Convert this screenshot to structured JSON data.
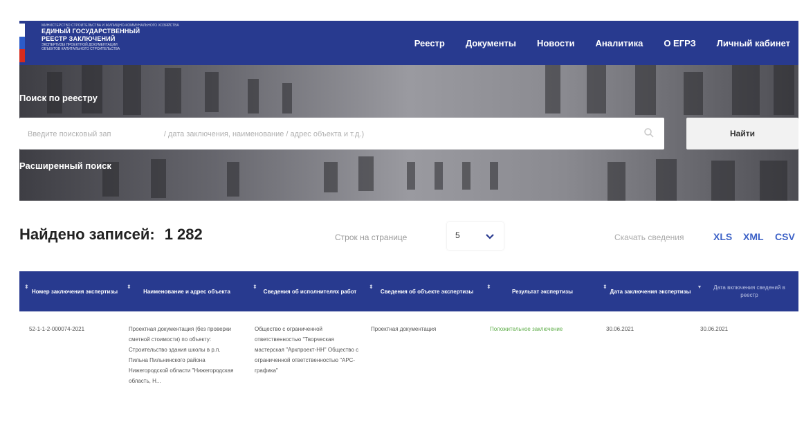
{
  "header": {
    "logo_small": "МИНИСТЕРСТВО СТРОИТЕЛЬСТВА И ЖИЛИЩНО-КОММУНАЛЬНОГО ХОЗЯЙСТВА",
    "logo_line1": "ЕДИНЫЙ ГОСУДАРСТВЕННЫЙ",
    "logo_line2": "РЕЕСТР ЗАКЛЮЧЕНИЙ",
    "logo_sub1": "ЭКСПЕРТИЗЫ ПРОЕКТНОЙ ДОКУМЕНТАЦИИ",
    "logo_sub2": "ОБЪЕКТОВ КАПИТАЛЬНОГО СТРОИТЕЛЬСТВА",
    "flag_colors": [
      "#ffffff",
      "#2c5bc9",
      "#d52b1e"
    ],
    "nav": [
      "Реестр",
      "Документы",
      "Новости",
      "Аналитика",
      "О ЕГРЗ",
      "Личный кабинет"
    ]
  },
  "hero": {
    "search_title": "Поиск по реестру",
    "search_placeholder": "Введите поисковый зап                         / дата заключения, наименование / адрес объекта и т.д.)",
    "search_icon": "search-icon",
    "find_label": "Найти",
    "advanced_label": "Расширенный поиск"
  },
  "results": {
    "found_label": "Найдено записей:",
    "found_count": "1 282",
    "rows_label": "Строк на странице",
    "rows_value": "5",
    "download_label": "Скачать сведения",
    "formats": [
      "XLS",
      "XML",
      "CSV"
    ]
  },
  "table": {
    "columns": [
      "Номер заключения экспертизы",
      "Наименование и адрес объекта",
      "Сведения об исполнителях работ",
      "Сведения об объекте экспертизы",
      "Результат экспертизы",
      "Дата заключения экспертизы",
      "Дата включения сведений в реестр"
    ],
    "row": {
      "number": "52-1-1-2-000074-2021",
      "object": "Проектная документация (без проверки сметной стоимости) по объекту: Строительство здания школы в р.п. Пильна Пильнинского района Нижегородской области \"Нижегородская область, Н...",
      "executors": "Общество с ограниченной ответственностью \"Творческая мастерская \"Архпроект-НН\" Общество с ограниченной ответственностью \"АРС-графика\"",
      "subject": "Проектная документация",
      "result": "Положительное заключение",
      "date_conclusion": "30.06.2021",
      "date_included": "30.06.2021"
    },
    "colors": {
      "header_bg": "#283a8f",
      "positive": "#5fae4a",
      "link": "#3d62c7"
    }
  }
}
